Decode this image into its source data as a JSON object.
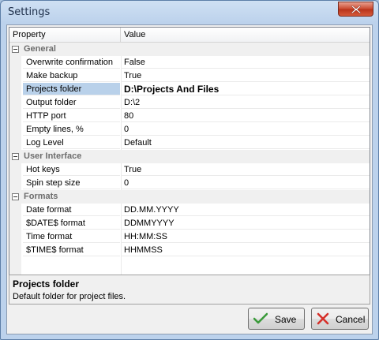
{
  "window": {
    "title": "Settings"
  },
  "grid": {
    "columns": {
      "property": "Property",
      "value": "Value"
    },
    "categories": [
      {
        "label": "General",
        "rows": [
          {
            "name": "Overwrite confirmation",
            "value": "False"
          },
          {
            "name": "Make backup",
            "value": "True"
          },
          {
            "name": "Projects folder",
            "value": "D:\\Projects And Files"
          },
          {
            "name": "Output folder",
            "value": "D:\\2"
          },
          {
            "name": "HTTP port",
            "value": "80"
          },
          {
            "name": "Empty lines, %",
            "value": "0"
          },
          {
            "name": "Log Level",
            "value": "Default"
          }
        ]
      },
      {
        "label": "User Interface",
        "rows": [
          {
            "name": "Hot keys",
            "value": "True"
          },
          {
            "name": "Spin step size",
            "value": "0"
          }
        ]
      },
      {
        "label": "Formats",
        "rows": [
          {
            "name": "Date format",
            "value": "DD.MM.YYYY"
          },
          {
            "name": "$DATE$ format",
            "value": "DDMMYYYY"
          },
          {
            "name": "Time format",
            "value": "HH:MM:SS"
          },
          {
            "name": "$TIME$ format",
            "value": "HHMMSS"
          }
        ]
      }
    ]
  },
  "description": {
    "title": "Projects folder",
    "text": "Default folder for project files."
  },
  "buttons": {
    "save": "Save",
    "cancel": "Cancel"
  }
}
